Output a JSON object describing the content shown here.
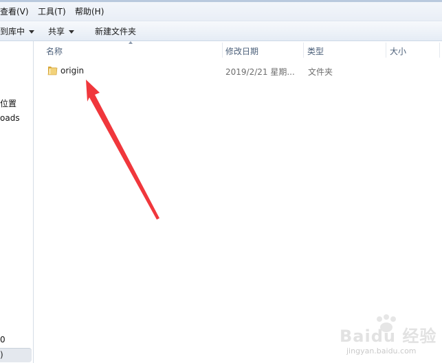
{
  "menu": {
    "view": "查看(V)",
    "tools": "工具(T)",
    "help": "帮助(H)"
  },
  "toolbar": {
    "include_in_library": "到库中",
    "share": "共享",
    "new_folder": "新建文件夹"
  },
  "nav_pane": {
    "items": [
      "位置",
      "oads",
      "0",
      ")"
    ]
  },
  "columns": {
    "name": "名称",
    "date_modified": "修改日期",
    "type": "类型",
    "size": "大小"
  },
  "files": [
    {
      "name": "origin",
      "date_modified": "2019/2/21 星期...",
      "type": "文件夹",
      "size": ""
    }
  ],
  "annotation": {
    "color": "#f0373c"
  },
  "watermark": {
    "brand": "Baidu 经验",
    "url": "jingyan.baidu.com"
  }
}
